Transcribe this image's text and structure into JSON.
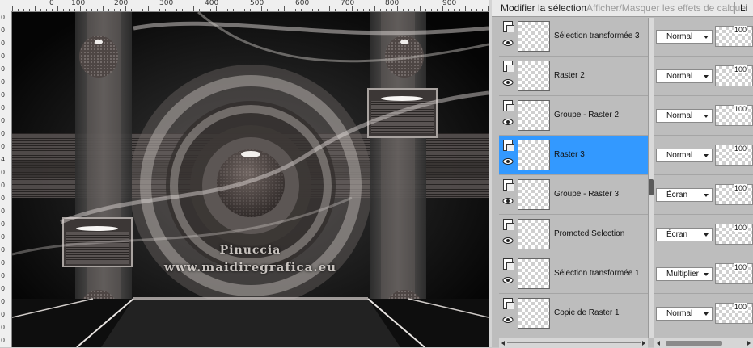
{
  "ruler": {
    "top_labels": [
      "0",
      "100",
      "200",
      "300",
      "400",
      "500",
      "600",
      "700",
      "800",
      "900"
    ],
    "left_labels": [
      "0",
      "0",
      "0",
      "0",
      "0",
      "0",
      "0",
      "0",
      "0",
      "0",
      "0",
      "4",
      "0",
      "0",
      "0",
      "0",
      "0",
      "0",
      "0",
      "0",
      "0",
      "0",
      "0",
      "0",
      "0",
      "0"
    ]
  },
  "canvas": {
    "watermark_line1": "Pinuccia",
    "watermark_line2": "www.maidiregrafica.eu"
  },
  "layers_panel": {
    "toolbar": {
      "modify_selection": "Modifier la sélection",
      "toggle_effects": "Afficher/Masquer les effets de calque",
      "next_item": "Li"
    },
    "layers": [
      {
        "name": "Sélection transformée 3",
        "blend": "Normal",
        "opacity": "100",
        "selected": false
      },
      {
        "name": "Raster 2",
        "blend": "Normal",
        "opacity": "100",
        "selected": false
      },
      {
        "name": "Groupe - Raster 2",
        "blend": "Normal",
        "opacity": "100",
        "selected": false
      },
      {
        "name": "Raster 3",
        "blend": "Normal",
        "opacity": "100",
        "selected": true
      },
      {
        "name": "Groupe - Raster 3",
        "blend": "Écran",
        "opacity": "100",
        "selected": false
      },
      {
        "name": "Promoted Selection",
        "blend": "Écran",
        "opacity": "100",
        "selected": false
      },
      {
        "name": "Sélection transformée 1",
        "blend": "Multiplier",
        "opacity": "100",
        "selected": false
      },
      {
        "name": "Copie de Raster 1",
        "blend": "Normal",
        "opacity": "100",
        "selected": false
      }
    ],
    "colors": {
      "selected_row": "#3399ff",
      "panel_bg": "#bdbdbd"
    }
  }
}
